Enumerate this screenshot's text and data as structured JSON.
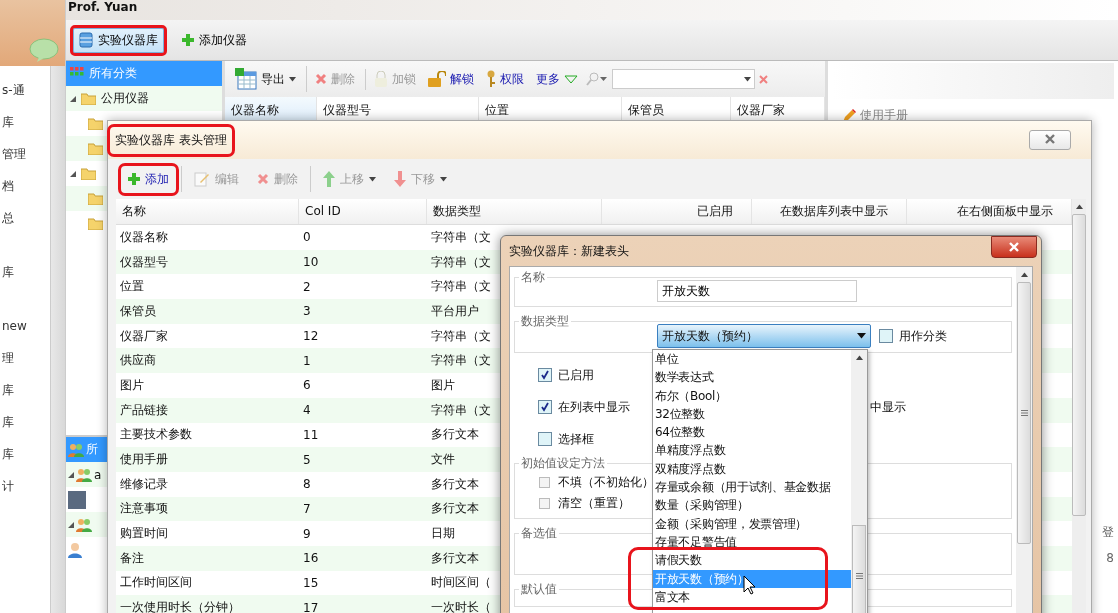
{
  "app": {
    "user": "Prof. Yuan",
    "side_labels": [
      "s-通",
      "库",
      "管理",
      "档",
      "总",
      "库",
      "new",
      "理",
      "库",
      "库",
      "库",
      "计"
    ]
  },
  "main_toolbar": [
    {
      "label": "实验仪器库",
      "selected": true,
      "highlighted": true
    },
    {
      "label": "添加仪器",
      "selected": false,
      "highlighted": false
    }
  ],
  "category_tree": [
    {
      "label": "所有分类",
      "selected": true,
      "expanded": false
    },
    {
      "label": "公用仪器",
      "selected": false,
      "expanded": true,
      "children": [
        {
          "selected": false
        },
        {
          "selected": false
        }
      ]
    },
    {
      "selected": false,
      "expanded": true,
      "children": [
        {
          "selected": false
        },
        {
          "selected": false
        }
      ]
    }
  ],
  "group_tree": [
    {
      "label": "所",
      "selected": true,
      "kind": "all"
    },
    {
      "label": "a",
      "selected": false,
      "kind": "group"
    },
    {
      "selected": false,
      "kind": "photo"
    },
    {
      "selected": false,
      "kind": "group"
    },
    {
      "selected": false,
      "kind": "user"
    }
  ],
  "instrument_toolbar": [
    {
      "label": "导出",
      "kind": "export",
      "disabled": false
    },
    {
      "label": "删除",
      "kind": "delete",
      "disabled": true
    },
    {
      "label": "加锁",
      "kind": "lock",
      "disabled": true
    },
    {
      "label": "解锁",
      "kind": "unlock",
      "disabled": false
    },
    {
      "label": "权限",
      "kind": "key",
      "disabled": false
    },
    {
      "label": "更多",
      "kind": "more",
      "disabled": false
    }
  ],
  "instrument_columns": [
    {
      "label": "仪器名称",
      "selected": true
    },
    {
      "label": "仪器型号",
      "selected": false
    },
    {
      "label": "位置",
      "selected": false
    },
    {
      "label": "保管员",
      "selected": false
    },
    {
      "label": "仪器厂家",
      "selected": false
    }
  ],
  "detail_panel": {
    "section": "使用手册",
    "side_texts": [
      "登",
      "8"
    ]
  },
  "header_dialog": {
    "title": "实验仪器库 表头管理",
    "highlighted": true,
    "toolbar": [
      {
        "label": "添加",
        "kind": "add",
        "disabled": false,
        "highlighted": true
      },
      {
        "label": "编辑",
        "kind": "edit",
        "disabled": true,
        "highlighted": false
      },
      {
        "label": "删除",
        "kind": "delete",
        "disabled": true,
        "highlighted": false
      },
      {
        "label": "上移",
        "kind": "up",
        "disabled": true,
        "highlighted": false
      },
      {
        "label": "下移",
        "kind": "down",
        "disabled": true,
        "highlighted": false
      }
    ],
    "columns": [
      "名称",
      "Col ID",
      "数据类型",
      "已启用",
      "在数据库列表中显示",
      "在右侧面板中显示"
    ],
    "rows": [
      [
        "仪器名称",
        "0",
        "字符串（文"
      ],
      [
        "仪器型号",
        "10",
        "字符串（文"
      ],
      [
        "位置",
        "2",
        "字符串（文"
      ],
      [
        "保管员",
        "3",
        "平台用户"
      ],
      [
        "仪器厂家",
        "12",
        "字符串（文"
      ],
      [
        "供应商",
        "1",
        "字符串（文"
      ],
      [
        "图片",
        "6",
        "图片"
      ],
      [
        "产品链接",
        "4",
        "字符串（文"
      ],
      [
        "主要技术参数",
        "11",
        "多行文本"
      ],
      [
        "使用手册",
        "5",
        "文件"
      ],
      [
        "维修记录",
        "8",
        "多行文本"
      ],
      [
        "注意事项",
        "7",
        "多行文本"
      ],
      [
        "购置时间",
        "9",
        "日期"
      ],
      [
        "备注",
        "16",
        "多行文本"
      ],
      [
        "工作时间区间",
        "15",
        "时间区间（"
      ],
      [
        "一次使用时长（分钟）",
        "17",
        "一次时长（"
      ]
    ]
  },
  "new_header_dialog": {
    "title": "实验仪器库：新建表头",
    "name_label": "名称",
    "name_value": "开放天数",
    "type_label": "数据类型",
    "type_value": "开放天数（预约）",
    "use_as_category": {
      "label": "用作分类",
      "checked": false
    },
    "options": [
      {
        "label": "已启用",
        "checked": true
      },
      {
        "label": "在列表中显示",
        "checked": true
      },
      {
        "label": "选择框",
        "checked": false
      }
    ],
    "partial_option": "中显示",
    "init_method": {
      "legend": "初始值设定方法",
      "choices": [
        {
          "label": "不填（不初始化）",
          "selected": false
        },
        {
          "label": "清空（重置）",
          "selected": false
        }
      ]
    },
    "candidates_legend": "备选值",
    "default_legend": "默认值",
    "type_options": [
      {
        "label": "单位",
        "selected": false,
        "highlighted": false
      },
      {
        "label": "数学表达式",
        "selected": false,
        "highlighted": false
      },
      {
        "label": "布尔（Bool）",
        "selected": false,
        "highlighted": false
      },
      {
        "label": "32位整数",
        "selected": false,
        "highlighted": false
      },
      {
        "label": "64位整数",
        "selected": false,
        "highlighted": false
      },
      {
        "label": "单精度浮点数",
        "selected": false,
        "highlighted": false
      },
      {
        "label": "双精度浮点数",
        "selected": false,
        "highlighted": false
      },
      {
        "label": "存量或余额（用于试剂、基金数据",
        "selected": false,
        "highlighted": false
      },
      {
        "label": "数量（采购管理）",
        "selected": false,
        "highlighted": false
      },
      {
        "label": "金额（采购管理，发票管理）",
        "selected": false,
        "highlighted": false
      },
      {
        "label": "存量不足警告值",
        "selected": false,
        "highlighted": false
      },
      {
        "label": "请假天数",
        "selected": false,
        "highlighted": true
      },
      {
        "label": "开放天数（预约）",
        "selected": true,
        "highlighted": true
      },
      {
        "label": "富文本",
        "selected": false,
        "highlighted": true
      }
    ]
  }
}
